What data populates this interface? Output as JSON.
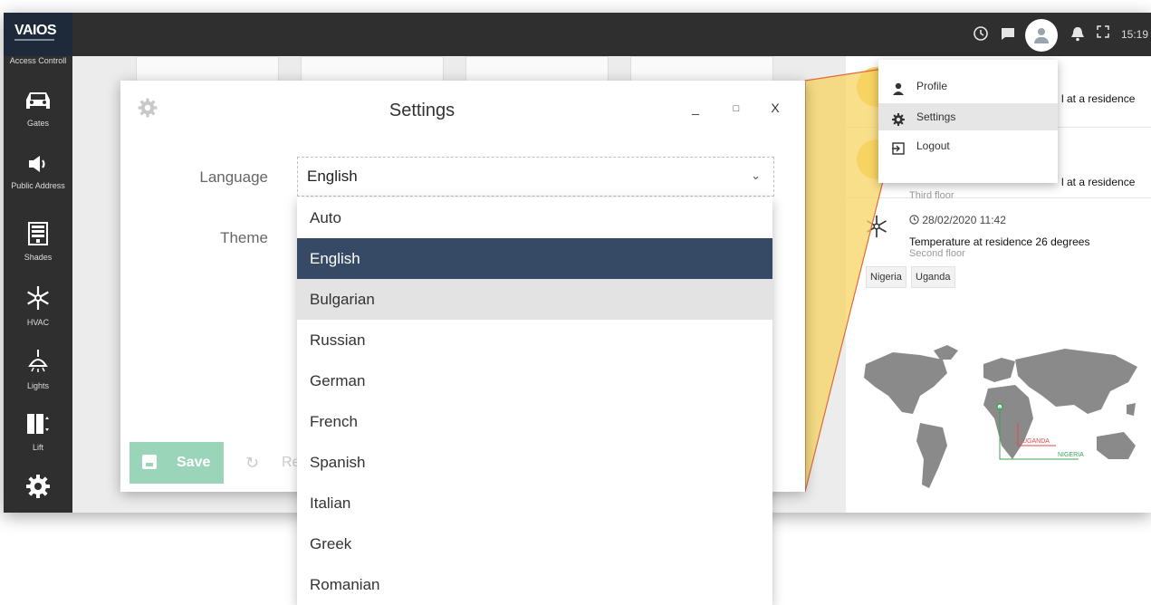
{
  "app": {
    "logo": "VAIOS",
    "time": "15:19"
  },
  "sidebar": {
    "items": [
      {
        "label": "Access Controll",
        "icon": "access-control-icon"
      },
      {
        "label": "Gates",
        "icon": "car-icon"
      },
      {
        "label": "Public Address",
        "icon": "speaker-icon"
      },
      {
        "label": "Shades",
        "icon": "shades-icon"
      },
      {
        "label": "HVAC",
        "icon": "snowflake-icon"
      },
      {
        "label": "Lights",
        "icon": "lamp-icon"
      },
      {
        "label": "Lift",
        "icon": "lift-icon"
      },
      {
        "label": "",
        "icon": "gear-icon"
      }
    ]
  },
  "topbar_icons": [
    "clock-icon",
    "chat-icon",
    "avatar-icon",
    "bell-icon",
    "fullscreen-icon"
  ],
  "dialog": {
    "title": "Settings",
    "minimize": "_",
    "maximize": "□",
    "close": "X",
    "language_label": "Language",
    "theme_label": "Theme",
    "language_value": "English",
    "save_label": "Save",
    "reset_label": "Re"
  },
  "language_options": [
    "Auto",
    "English",
    "Bulgarian",
    "Russian",
    "German",
    "French",
    "Spanish",
    "Italian",
    "Greek",
    "Romanian"
  ],
  "selected_language_index": 1,
  "hover_language_index": 2,
  "profile_menu": {
    "items": [
      {
        "label": "Profile",
        "icon": "user-icon"
      },
      {
        "label": "Settings",
        "icon": "gear-icon"
      },
      {
        "label": "Logout",
        "icon": "logout-icon"
      }
    ]
  },
  "notifications": [
    {
      "text": "l at a residence",
      "sub": ""
    },
    {
      "text": "l at a residence",
      "sub": "Third floor"
    },
    {
      "time": "28/02/2020 11:42",
      "text": "Temperature at residence 26 degrees",
      "sub": "Second floor"
    }
  ],
  "countries": [
    "Nigeria",
    "Uganda"
  ],
  "map_labels": {
    "uganda": "UGANDA",
    "nigeria": "NIGERIA"
  },
  "colors": {
    "sidebar": "#2f2f2f",
    "selected": "#364a66",
    "save": "#9ad4b9",
    "callout": "#f7d462",
    "map": "#8a8a8a"
  }
}
